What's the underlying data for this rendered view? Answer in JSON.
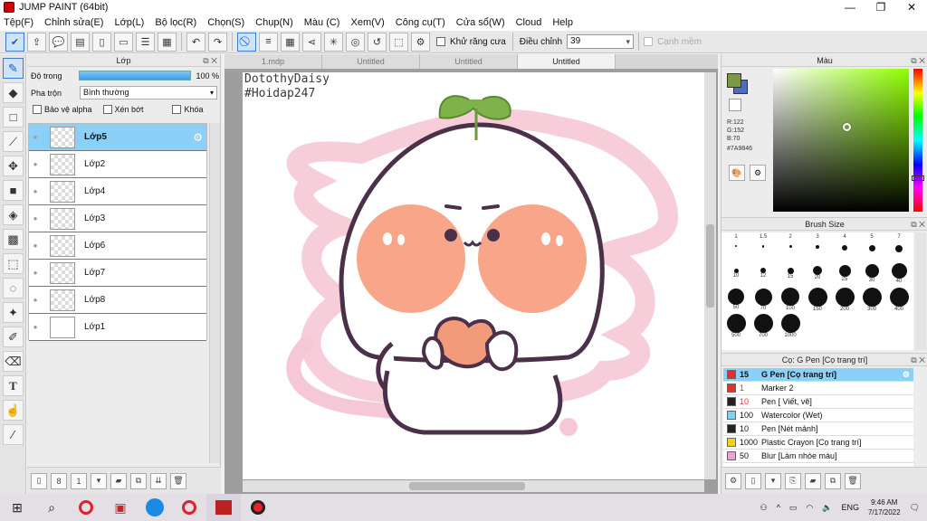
{
  "app": {
    "title": "JUMP PAINT (64bit)"
  },
  "menu": [
    "Tệp(F)",
    "Chỉnh sửa(E)",
    "Lớp(L)",
    "Bộ lọc(R)",
    "Chọn(S)",
    "Chụp(N)",
    "Màu (C)",
    "Xem(V)",
    "Công cụ(T)",
    "Cửa sổ(W)",
    "Cloud",
    "Help"
  ],
  "toolbar": {
    "antialias_label": "Khử răng cưa",
    "adjust_label": "Điều chỉnh",
    "adjust_value": "39",
    "snap_label": "Cạnh mềm"
  },
  "layer_panel": {
    "title": "Lớp",
    "opacity_label": "Độ trong",
    "opacity_value": "100 %",
    "opacity_fraction": 1.0,
    "blend_label": "Pha trộn",
    "blend_value": "Bình thường",
    "protect_alpha": "Bảo vệ alpha",
    "clip": "Xén bớt",
    "lock": "Khóa",
    "layers": [
      {
        "name": "Lớp5",
        "selected": true
      },
      {
        "name": "Lớp2"
      },
      {
        "name": "Lớp4"
      },
      {
        "name": "Lớp3"
      },
      {
        "name": "Lớp6"
      },
      {
        "name": "Lớp7"
      },
      {
        "name": "Lớp8"
      },
      {
        "name": "Lớp1"
      }
    ]
  },
  "tabs": [
    {
      "label": "1.mdp"
    },
    {
      "label": "Untitled"
    },
    {
      "label": "Untitled"
    },
    {
      "label": "Untitled",
      "active": true
    }
  ],
  "canvas": {
    "watermark_1": "DotothyDaisy",
    "watermark_2": "#Hoidap247"
  },
  "color_panel": {
    "title": "Màu",
    "r": "R:122",
    "g": "G:152",
    "b": "B:70",
    "hex": "#7A9846",
    "fg": "#7a9846",
    "bg": "#4b6ec1"
  },
  "brush_size": {
    "title": "Brush Size",
    "sizes": [
      "1",
      "1.5",
      "2",
      "3",
      "4",
      "5",
      "7",
      "10",
      "12",
      "15",
      "20",
      "25",
      "30",
      "40",
      "50",
      "70",
      "100",
      "150",
      "200",
      "300",
      "400",
      "500",
      "700",
      "1000"
    ]
  },
  "brush_list": {
    "title": "Cọ: G Pen [Cọ trang trí]",
    "items": [
      {
        "size": "15",
        "name": "G Pen [Cọ trang trí]",
        "color": "#e03030",
        "selected": true
      },
      {
        "size": "1",
        "name": "Marker 2",
        "color": "#e03030"
      },
      {
        "size": "10",
        "name": "Pen [ Viết, vẽ]",
        "color": "#e03030"
      },
      {
        "size": "100",
        "name": "Watercolor (Wet)",
        "color": "#7fd0f0"
      },
      {
        "size": "10",
        "name": "Pen [Nét mảnh]",
        "color": "#222222"
      },
      {
        "size": "1000",
        "name": "Plastic Crayon [Cọ trang trí]",
        "color": "#f0d020"
      },
      {
        "size": "50",
        "name": "Blur [Làm nhòe màu]",
        "color": "#f0a0d0"
      }
    ]
  },
  "taskbar": {
    "lang": "ENG",
    "time": "9:46 AM",
    "date": "7/17/2022"
  }
}
